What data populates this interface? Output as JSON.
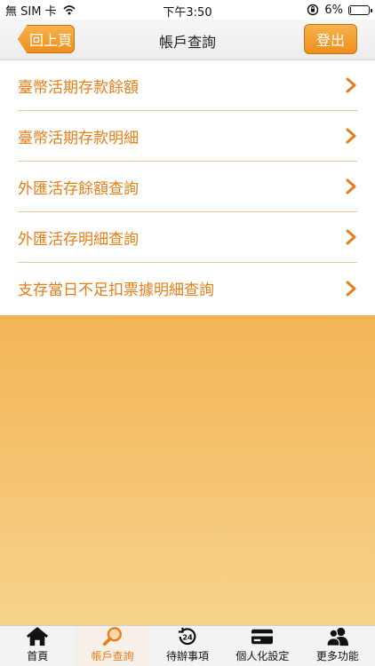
{
  "status_bar": {
    "carrier": "無 SIM 卡",
    "time": "下午3:50",
    "battery_percent": "6%",
    "battery_level": 0.06
  },
  "nav": {
    "back_label": "回上頁",
    "title": "帳戶查詢",
    "logout_label": "登出"
  },
  "menu": {
    "items": [
      {
        "label": "臺幣活期存款餘額"
      },
      {
        "label": "臺幣活期存款明細"
      },
      {
        "label": "外匯活存餘額查詢"
      },
      {
        "label": "外匯活存明細查詢"
      },
      {
        "label": "支存當日不足扣票據明細查詢"
      }
    ]
  },
  "tabs": [
    {
      "label": "首頁",
      "icon": "home-icon",
      "active": false
    },
    {
      "label": "帳戶查詢",
      "icon": "magnifier-icon",
      "active": true
    },
    {
      "label": "待辦事項",
      "icon": "clock-24-icon",
      "active": false
    },
    {
      "label": "個人化設定",
      "icon": "card-icon",
      "active": false
    },
    {
      "label": "更多功能",
      "icon": "users-icon",
      "active": false
    }
  ],
  "colors": {
    "accent": "#e67e18",
    "button_orange": "#ee8f1c",
    "background_gradient_top": "#f4b455",
    "background_gradient_bottom": "#f6d38c"
  }
}
